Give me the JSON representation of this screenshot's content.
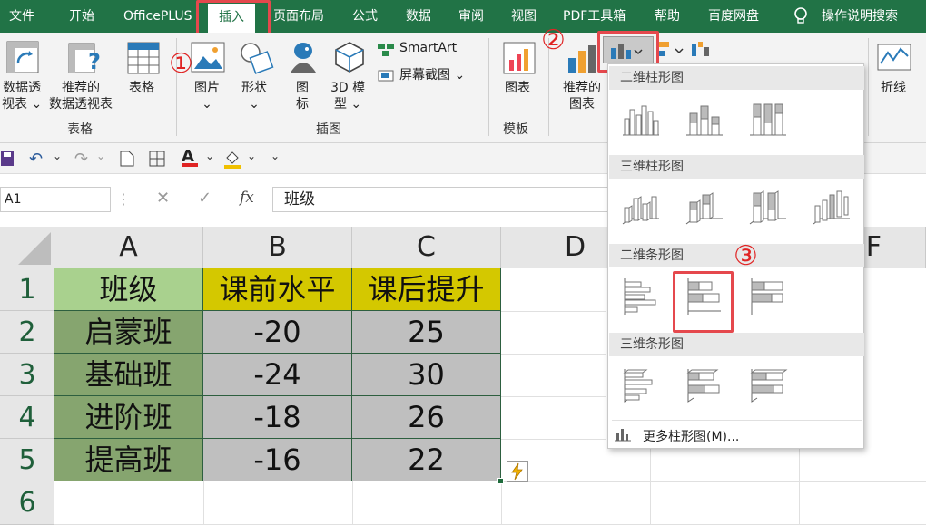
{
  "menu": {
    "tabs": [
      "文件",
      "开始",
      "OfficePLUS",
      "插入",
      "页面布局",
      "公式",
      "数据",
      "审阅",
      "视图",
      "PDF工具箱",
      "帮助",
      "百度网盘"
    ],
    "active": "插入",
    "tell_me": "操作说明搜索"
  },
  "ribbon": {
    "pivot_line1": "数据透",
    "pivot_line2": "视表",
    "rec_pivot_line1": "推荐的",
    "rec_pivot_line2": "数据透视表",
    "table": "表格",
    "group_table": "表格",
    "pictures": "图片",
    "shapes": "形状",
    "icons_line1": "图",
    "icons_line2": "标",
    "model3d_line1": "3D 模",
    "model3d_line2": "型",
    "smartart": "SmartArt",
    "screenshot": "屏幕截图",
    "group_illus": "插图",
    "template_chart": "图表",
    "group_template": "模板",
    "rec_chart_line1": "推荐的",
    "rec_chart_line2": "图表",
    "line": "折线"
  },
  "annotations": [
    "①",
    "②",
    "③"
  ],
  "formula": {
    "namebox": "A1",
    "fx": "fx",
    "value": "班级"
  },
  "grid": {
    "columns": [
      "A",
      "B",
      "C",
      "D",
      "F"
    ],
    "rows": [
      "1",
      "2",
      "3",
      "4",
      "5",
      "6"
    ],
    "header": [
      "班级",
      "课前水平",
      "课后提升"
    ],
    "data": [
      [
        "启蒙班",
        "-20",
        "25"
      ],
      [
        "基础班",
        "-24",
        "30"
      ],
      [
        "进阶班",
        "-18",
        "26"
      ],
      [
        "提高班",
        "-16",
        "22"
      ]
    ]
  },
  "dropdown": {
    "sections": [
      "二维柱形图",
      "三维柱形图",
      "二维条形图",
      "三维条形图"
    ],
    "more": "更多柱形图(M)..."
  },
  "colors": {
    "excel_green": "#217346",
    "header_fill": "#a9d18e",
    "yellow_fill": "#d4c800",
    "gray_fill": "#bfbfbf",
    "annotation_red": "#e5484d"
  }
}
